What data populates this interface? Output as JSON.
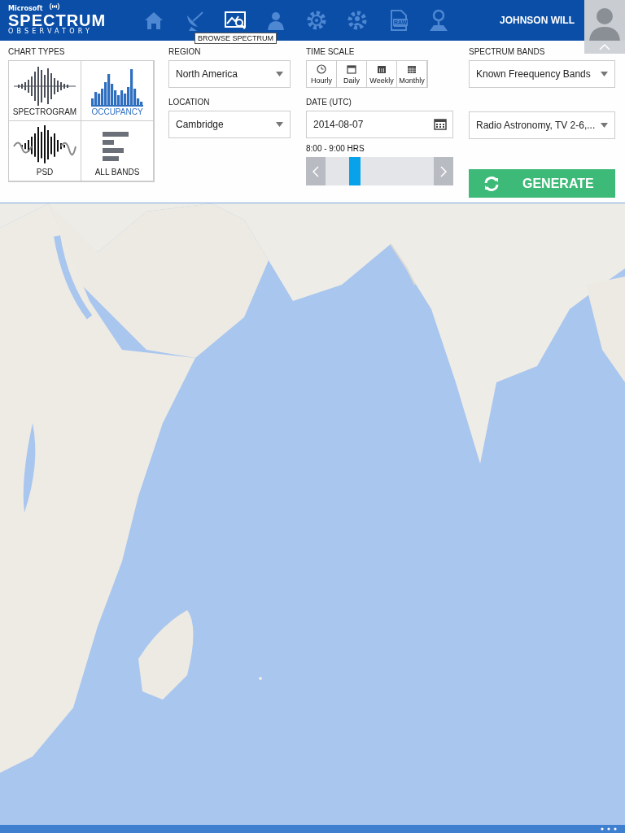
{
  "header": {
    "logo": {
      "brand": "Microsoft",
      "title": "SPECTRUM",
      "subtitle": "OBSERVATORY"
    },
    "nav": [
      {
        "kind": "home",
        "selected": false
      },
      {
        "kind": "satellite",
        "selected": false
      },
      {
        "kind": "browse",
        "selected": true,
        "tooltip": "BROWSE SPECTRUM"
      },
      {
        "kind": "person",
        "selected": false
      },
      {
        "kind": "gear-signal",
        "selected": false
      },
      {
        "kind": "gear-person",
        "selected": false
      },
      {
        "kind": "raw-file",
        "selected": false,
        "badge": "RAW"
      },
      {
        "kind": "map-pin",
        "selected": false
      }
    ],
    "user": "JOHNSON WILL"
  },
  "chart_types": {
    "label": "CHART TYPES",
    "items": [
      {
        "kind": "spectrogram",
        "label": "SPECTROGRAM",
        "selected": false
      },
      {
        "kind": "occupancy",
        "label": "OCCUPANCY",
        "selected": true
      },
      {
        "kind": "psd",
        "label": "PSD",
        "selected": false
      },
      {
        "kind": "bands",
        "label": "ALL BANDS",
        "selected": false
      }
    ]
  },
  "region": {
    "label": "REGION",
    "value": "North America"
  },
  "location": {
    "label": "LOCATION",
    "value": "Cambridge"
  },
  "time_scale": {
    "label": "TIME SCALE",
    "options": [
      {
        "kind": "clock",
        "label": "Hourly"
      },
      {
        "kind": "day",
        "label": "Daily"
      },
      {
        "kind": "week",
        "label": "Weekly"
      },
      {
        "kind": "month",
        "label": "Monthly"
      }
    ]
  },
  "date": {
    "label": "DATE (UTC)",
    "value": "2014-08-07"
  },
  "time_range": {
    "label": "8:00 - 9:00 HRS",
    "level": 0.27
  },
  "spectrum_bands": {
    "label": "SPECTRUM BANDS",
    "band_type": "Known Freequency Bands",
    "bands": "Radio Astronomy, TV 2-6,..."
  },
  "generate": "GENERATE"
}
